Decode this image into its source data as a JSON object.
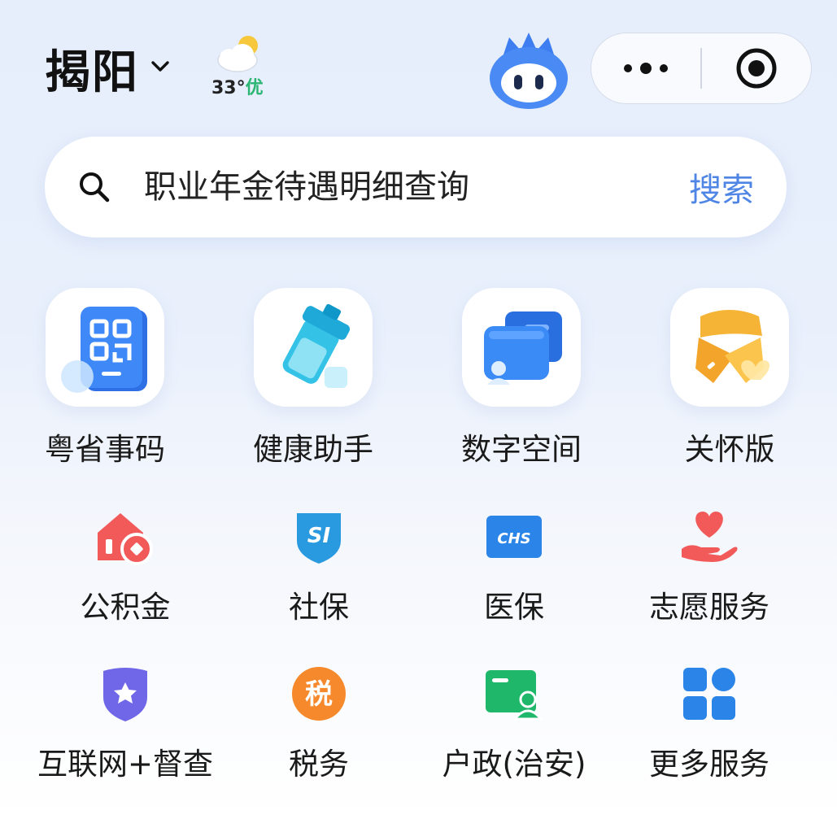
{
  "header": {
    "city": "揭阳",
    "weather": {
      "temperature": "33°",
      "air_quality": "优",
      "icon": "partly-cloudy-icon"
    },
    "mascot": "mascot-icon",
    "capsule": {
      "more": "more-dots-icon",
      "close": "target-circle-icon"
    }
  },
  "search": {
    "placeholder": "职业年金待遇明细查询",
    "button_label": "搜索",
    "accent_color": "#4f86e6"
  },
  "featured": [
    {
      "label": "粤省事码",
      "icon": "qr-code-card-icon"
    },
    {
      "label": "健康助手",
      "icon": "health-kit-icon"
    },
    {
      "label": "数字空间",
      "icon": "digital-wallet-icon"
    },
    {
      "label": "关怀版",
      "icon": "care-ribbon-icon"
    }
  ],
  "services_row1": [
    {
      "label": "公积金",
      "icon": "housing-fund-icon"
    },
    {
      "label": "社保",
      "icon": "social-security-icon",
      "icon_text": "SI"
    },
    {
      "label": "医保",
      "icon": "medical-insurance-icon",
      "icon_text": "CHS"
    },
    {
      "label": "志愿服务",
      "icon": "volunteer-heart-icon"
    }
  ],
  "services_row2": [
    {
      "label": "互联网+督查",
      "icon": "star-shield-icon"
    },
    {
      "label": "税务",
      "icon": "tax-icon",
      "icon_text": "税"
    },
    {
      "label": "户政(治安)",
      "icon": "household-card-icon"
    },
    {
      "label": "更多服务",
      "icon": "more-grid-icon"
    }
  ]
}
